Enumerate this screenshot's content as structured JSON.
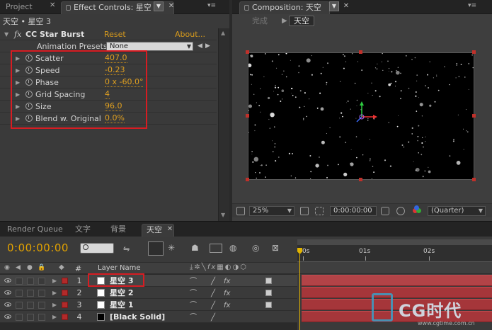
{
  "panels": {
    "project_tab": "Project",
    "effect_controls_tab": "Effect Controls: 星空 3",
    "composition_tab": "Composition: 天空"
  },
  "effect_controls": {
    "breadcrumb": "天空 • 星空 3",
    "fx_badge": "fx",
    "effect_name": "CC Star Burst",
    "reset": "Reset",
    "about": "About...",
    "presets_label": "Animation Presets:",
    "presets_value": "None",
    "params": [
      {
        "name": "Scatter",
        "value": "407.0"
      },
      {
        "name": "Speed",
        "value": "-0.23"
      },
      {
        "name": "Phase",
        "value": "0 x -60.0°"
      },
      {
        "name": "Grid Spacing",
        "value": "4"
      },
      {
        "name": "Size",
        "value": "96.0"
      },
      {
        "name": "Blend w. Original",
        "value": "0.0%"
      }
    ]
  },
  "composition": {
    "subtab_done": "完成",
    "subtab_active": "天空",
    "zoom": "25%",
    "timecode": "0:00:00:00",
    "resolution": "(Quarter)"
  },
  "timeline": {
    "tabs": [
      "Render Queue",
      "文字",
      "背景",
      "天空"
    ],
    "current_time": "0:00:00:00",
    "col_hash": "#",
    "col_layer_name": "Layer Name",
    "ruler": [
      "0s",
      "01s",
      "02s"
    ],
    "layers": [
      {
        "num": "1",
        "name": "星空 3",
        "color": "#ffffff"
      },
      {
        "num": "2",
        "name": "星空 2",
        "color": "#ffffff"
      },
      {
        "num": "3",
        "name": "星空 1",
        "color": "#ffffff"
      },
      {
        "num": "4",
        "name": "[Black Solid]",
        "color": "#000000"
      }
    ]
  },
  "watermark": {
    "brand": "CG时代",
    "url": "www.cgtime.com.cn"
  },
  "colors": {
    "accent_orange": "#d89b1c",
    "highlight_red": "#d71c22",
    "layer_bar": "#a5363a",
    "timecode_gold": "#e2a200"
  }
}
